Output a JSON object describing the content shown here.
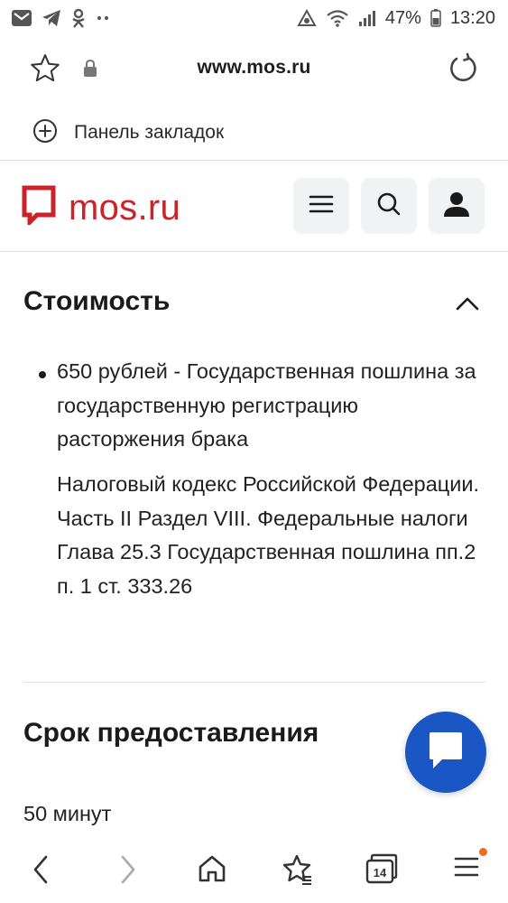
{
  "status_bar": {
    "battery": "47%",
    "time": "13:20"
  },
  "browser": {
    "url": "www.mos.ru",
    "bookmarks_label": "Панель закладок",
    "tab_count": "14"
  },
  "site": {
    "logo_text": "mos.ru",
    "brand_color": "#cc2229"
  },
  "cost_section": {
    "title": "Стоимость",
    "item": "650 рублей - Государственная пошлина за государственную регистрацию расторжения брака",
    "note": "Налоговый кодекс Российской Федерации. Часть II Раздел VIII. Федеральные налоги Глава 25.3 Государственная пошлина пп.2 п. 1 ст. 333.26"
  },
  "term_section": {
    "title": "Срок предоставления",
    "value": "50 минут"
  },
  "icons": {
    "status_left": [
      "mail-icon",
      "telegram-icon",
      "odnoklassniki-icon",
      "more-dots-icon"
    ],
    "status_right": [
      "data-saver-icon",
      "wifi-icon",
      "signal-icon",
      "battery-icon"
    ],
    "bottom_nav": [
      "back-icon",
      "forward-icon",
      "home-icon",
      "bookmarks-icon",
      "tabs-icon",
      "menu-icon"
    ]
  },
  "colors": {
    "chat_button": "#1a56c4",
    "notification_dot": "#f26a1b"
  }
}
